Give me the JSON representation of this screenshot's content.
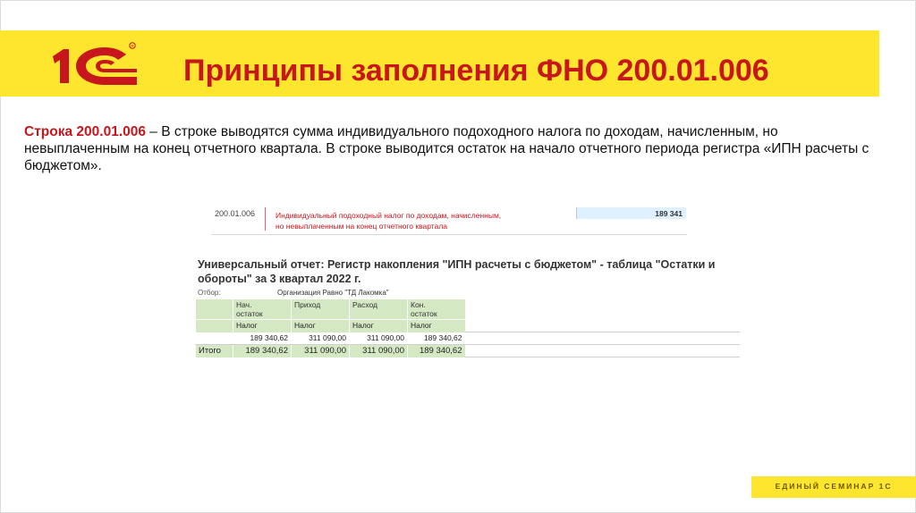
{
  "header": {
    "title": "Принципы заполнения ФНО 200.01.006",
    "logo_text": "1С",
    "colors": {
      "band": "#fde62d",
      "brand_red": "#c8161d"
    }
  },
  "body": {
    "lead": "Строка 200.01.006",
    "text": " – В строке выводятся сумма индивидуального подоходного налога по доходам, начисленным, но невыплаченным на конец отчетного квартала. В строке выводится остаток на начало отчетного периода регистра «ИПН расчеты с бюджетом»."
  },
  "form_row": {
    "code": "200.01.006",
    "description_line1": "Индивидуальный подоходный налог по доходам, начисленным,",
    "description_line2": "но невыплаченным на конец отчетного квартала",
    "value": "189 341"
  },
  "report": {
    "title": "Универсальный отчет: Регистр накопления \"ИПН расчеты с бюджетом\" - таблица \"Остатки и обороты\" за 3 квартал 2022 г.",
    "filter_label": "Отбор:",
    "filter_value": "Организация Равно \"ТД Лакомка\"",
    "columns": [
      {
        "line1": "Нач.",
        "line2": "остаток"
      },
      {
        "line1": "Приход",
        "line2": ""
      },
      {
        "line1": "Расход",
        "line2": ""
      },
      {
        "line1": "Кон.",
        "line2": "остаток"
      }
    ],
    "sub_header": [
      "Налог",
      "Налог",
      "Налог",
      "Налог"
    ],
    "data_row": [
      "189 340,62",
      "311 090,00",
      "311 090,00",
      "189 340,62"
    ],
    "total_label": "Итого",
    "total_row": [
      "189 340,62",
      "311 090,00",
      "311 090,00",
      "189 340,62"
    ]
  },
  "footer": {
    "text": "ЕДИНЫЙ СЕМИНАР 1С"
  }
}
